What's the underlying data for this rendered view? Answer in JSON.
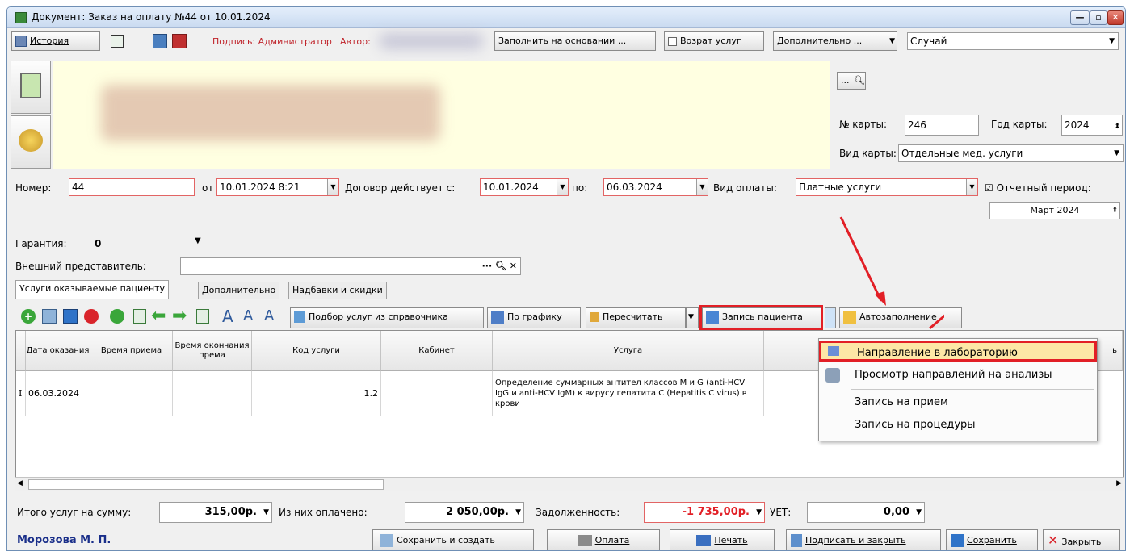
{
  "window": {
    "title": "Документ: Заказ на оплату №44 от 10.01.2024"
  },
  "toolbar": {
    "history_label": "История",
    "signature_label": "Подпись: Администратор",
    "author_label": "Автор:",
    "fill_basis_label": "Заполнить на основании ...",
    "return_services_label": "Возрат услуг",
    "additional_label": "Дополнительно ...",
    "case_value": "Случай"
  },
  "card": {
    "ellipsis": "...",
    "card_no_label": "№ карты:",
    "card_no_value": "246",
    "card_year_label": "Год карты:",
    "card_year_value": "2024",
    "card_type_label": "Вид карты:",
    "card_type_value": "Отдельные мед. услуги"
  },
  "order": {
    "number_label": "Номер:",
    "number_value": "44",
    "from_label": "от",
    "from_value": "10.01.2024 8:21",
    "contract_label": "Договор действует с:",
    "contract_from": "10.01.2024",
    "to_label": "по:",
    "contract_to": "06.03.2024",
    "payment_type_label": "Вид оплаты:",
    "payment_type_value": "Платные услуги",
    "report_period_label": "Отчетный период:",
    "report_period_value": "Март   2024",
    "guarantee_label": "Гарантия:",
    "guarantee_value": "0",
    "ext_rep_label": "Внешний представитель:",
    "ext_rep_value": ""
  },
  "tabs": [
    "Услуги оказываемые пациенту",
    "Дополнительно",
    "Надбавки и скидки"
  ],
  "services_toolbar": {
    "pick_label": "Подбор услуг из справочника",
    "schedule_label": "По графику",
    "recalc_label": "Пересчитать",
    "patient_record_label": "Запись пациента",
    "autofill_label": "Автозаполнение"
  },
  "grid": {
    "headers": [
      "Дата оказания",
      "Время приема",
      "Время окончания према",
      "Код услуги",
      "Кабинет",
      "Услуга",
      "ь"
    ],
    "row": {
      "marker": "I",
      "date": "06.03.2024",
      "time": "",
      "time_end": "",
      "code": "1.2",
      "cabinet": "",
      "service": "Определение суммарных антител классов M и G (anti-HCV IgG и anti-HCV IgM) к вирусу гепатита C (Hepatitis C virus) в крови"
    }
  },
  "menu": {
    "items": [
      "Направление в лабораторию",
      "Просмотр направлений на анализы",
      "Запись на прием",
      "Запись на процедуры"
    ]
  },
  "totals": {
    "total_label": "Итого услуг на сумму:",
    "total_value": "315,00р.",
    "paid_label": "Из них оплачено:",
    "paid_value": "2 050,00р.",
    "debt_label": "Задолженность:",
    "debt_value": "-1 735,00р.",
    "uet_label": "УЕТ:",
    "uet_value": "0,00"
  },
  "footer": {
    "user": "Морозова М. П.",
    "save_create": "Сохранить и создать",
    "payment": "Оплата",
    "print": "Печать",
    "sign_close": "Подписать и закрыть",
    "save": "Сохранить",
    "close": "Закрыть"
  },
  "colors": {
    "highlight_red": "#e21f26",
    "menu_highlight": "#fde7a6",
    "yellow_panel": "#ffffe1",
    "debt_red": "#e21f26",
    "user_blue": "#1a2f8a"
  }
}
